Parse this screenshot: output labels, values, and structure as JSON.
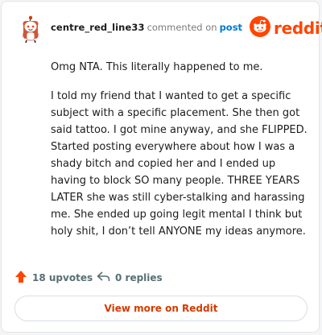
{
  "comment": {
    "username": "centre_red_line33",
    "verb": "commented on",
    "post_link": "post",
    "paragraphs": [
      "Omg NTA. This literally happened to me.",
      "I told my friend that I wanted to get a specific subject with a specific placement. She then got said tattoo. I got mine anyway, and she FLIPPED. Started posting everywhere about how I was a shady bitch and copied her and I ended up having to block SO many people. THREE YEARS LATER she was still cyber-stalking and harassing me. She ended up going legit mental I think but holy shit, I don’t tell ANYONE my ideas anymore."
    ],
    "upvotes_label": "18 upvotes",
    "replies_label": "0 replies"
  },
  "brand": {
    "name": "reddit",
    "color": "#ff4500"
  },
  "footer": {
    "view_more_label": "View more on Reddit"
  },
  "icons": {
    "avatar": "snoo-avatar-icon",
    "logo": "reddit-logo-icon",
    "upvote": "upvote-arrow-icon",
    "reply": "reply-arrow-icon"
  }
}
